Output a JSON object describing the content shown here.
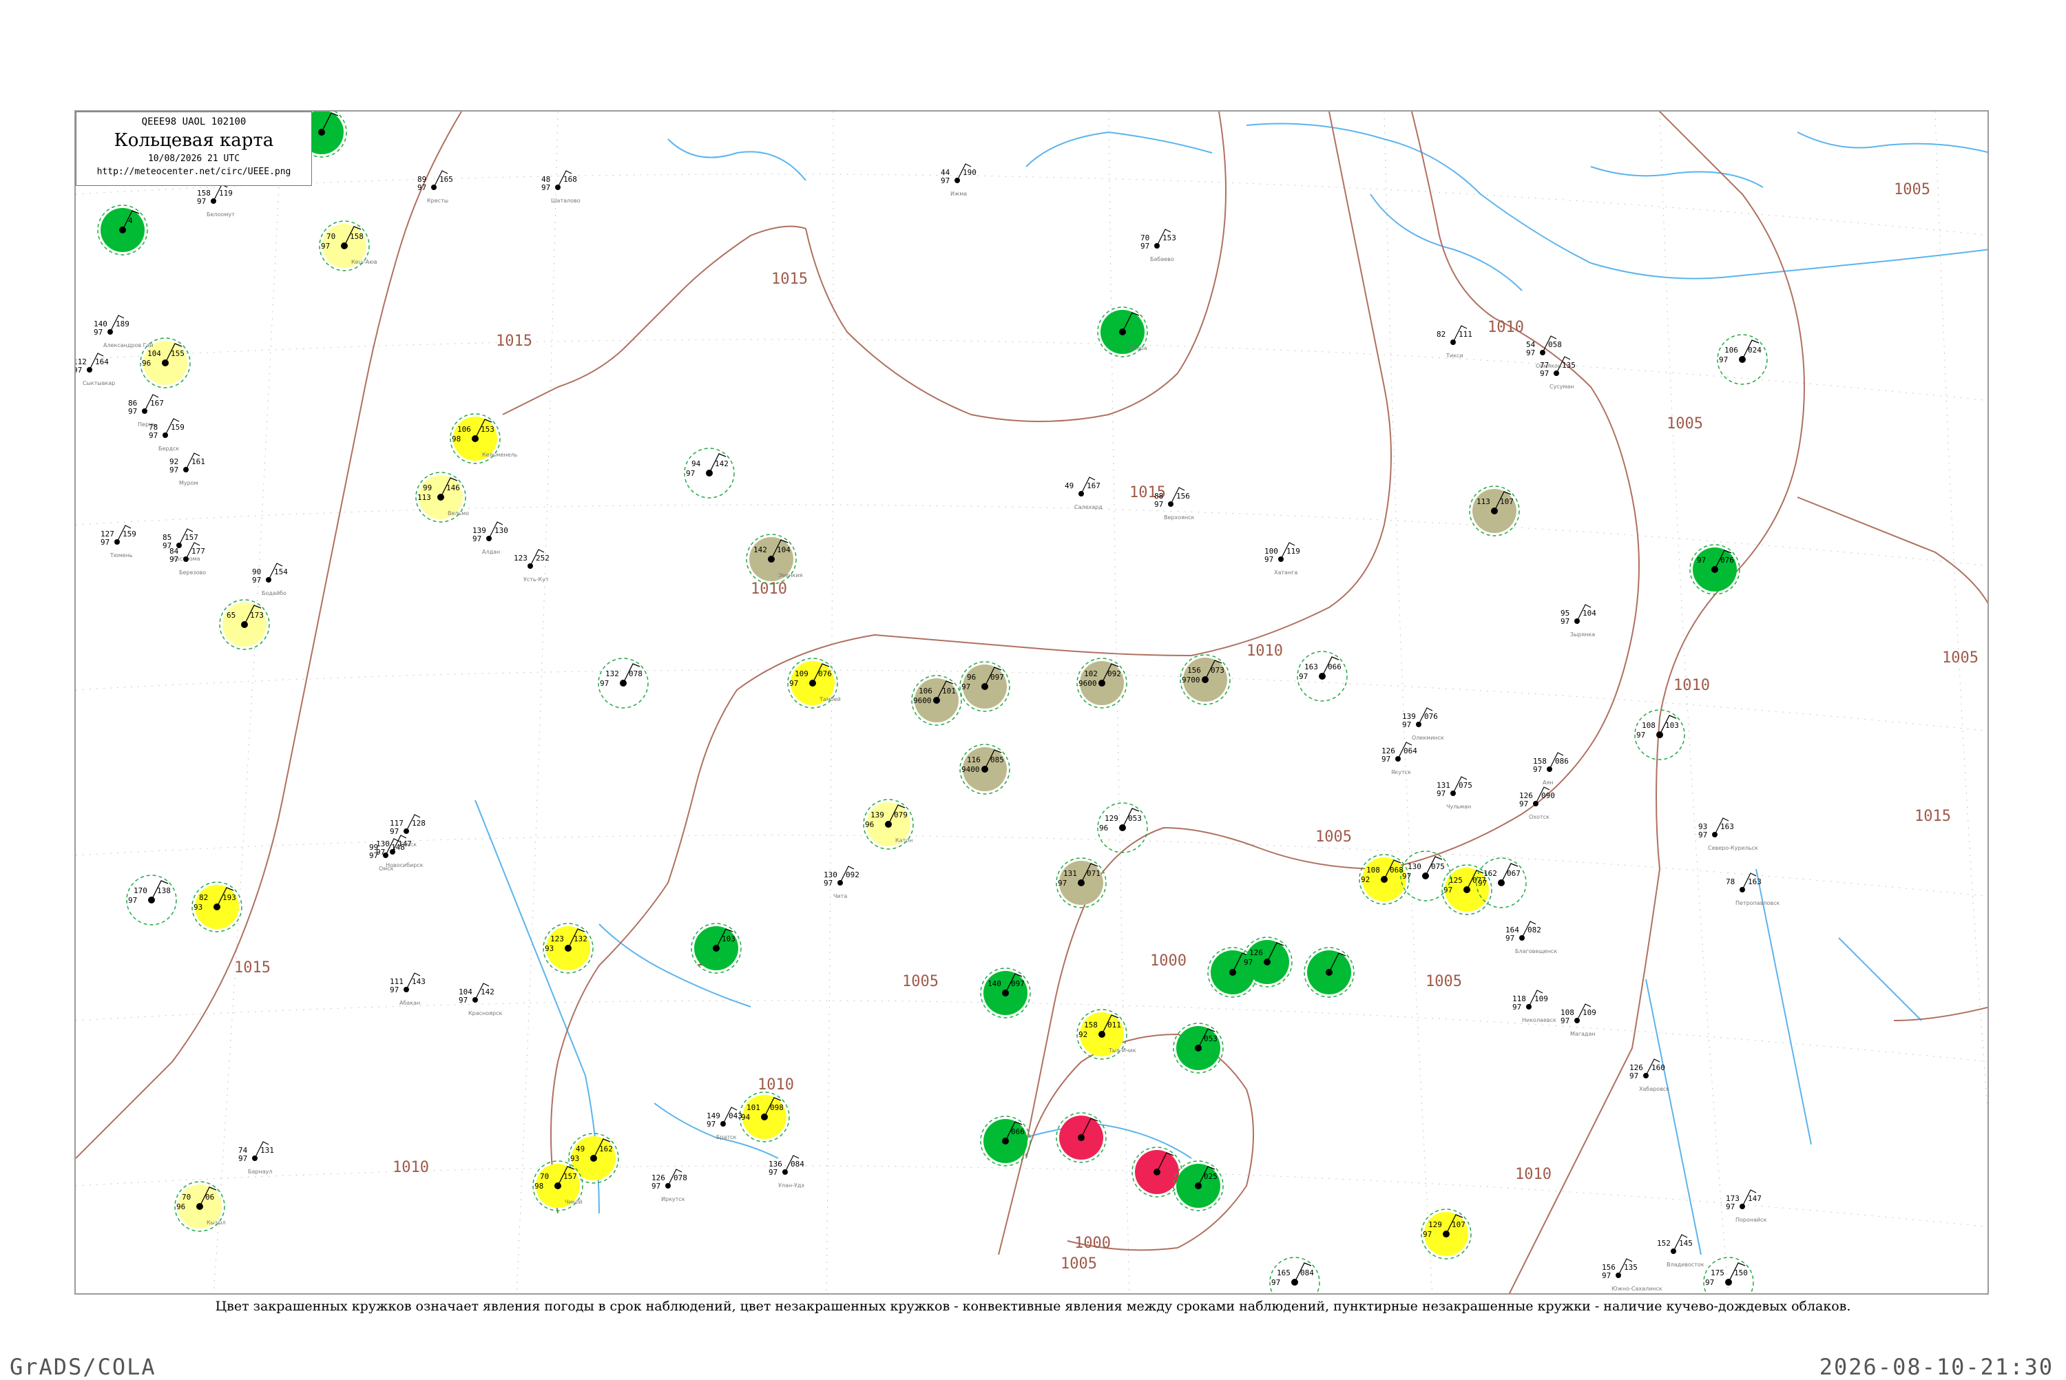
{
  "header": {
    "code": "QEEE98  UAOL  102100",
    "title": "Кольцевая карта",
    "date": "10/08/2026 21 UTC",
    "url": "http://meteocenter.net/circ/UEEE.png"
  },
  "legend_text": "Цвет закрашенных кружков означает явления погоды в срок наблюдений, цвет незакрашенных кружков - конвективные явления между сроками наблюдений, пунктирные незакрашенные кружки - наличие кучево-дождевых облаков.",
  "software": "GrADS/COLA",
  "timestamp": "2026-08-10-21:30",
  "colors": {
    "green": "#00bb33",
    "yellow": "#ffff22",
    "pale_yellow": "#ffff99",
    "olive": "#bdb98e",
    "red": "#ee2255",
    "dashed_ring": "#22aa44",
    "isobar": "#b07060",
    "river": "#44aaee",
    "gridline": "#bbbbbb"
  },
  "isobar_labels": [
    "1015",
    "1015",
    "1015",
    "1015",
    "1010",
    "1010",
    "1010",
    "1010",
    "1010",
    "1010",
    "1010",
    "1005",
    "1005",
    "1005",
    "1005",
    "1005",
    "1005",
    "1005",
    "1000",
    "1000",
    "1015",
    "1010"
  ],
  "stations": [
    {
      "id": "s01",
      "kind": "green",
      "name": "",
      "top": "",
      "left": "",
      "right": ""
    },
    {
      "id": "s02",
      "kind": "green",
      "name": "",
      "top": "",
      "left": "",
      "right": ""
    },
    {
      "id": "s03",
      "kind": "green",
      "name": "",
      "top": "",
      "left": "",
      "right": "4"
    },
    {
      "id": "s04",
      "kind": "pale_yellow",
      "name": "Кеш-Аюв",
      "top": "70",
      "left": "97",
      "right": "158"
    },
    {
      "id": "s05",
      "kind": "pale_yellow",
      "name": "",
      "top": "104",
      "left": "96",
      "right": "155"
    },
    {
      "id": "s06",
      "kind": "yellow",
      "name": "Кельменель",
      "top": "106",
      "left": "98",
      "right": "153"
    },
    {
      "id": "s07",
      "kind": "pale_yellow",
      "name": "Вельмо",
      "top": "99",
      "left": "113",
      "right": "146"
    },
    {
      "id": "s08",
      "kind": "green",
      "name": "Ичара",
      "top": "",
      "left": "",
      "right": ""
    },
    {
      "id": "s09",
      "kind": "ring",
      "name": "",
      "top": "94",
      "left": "97",
      "right": "142"
    },
    {
      "id": "s10",
      "kind": "olive",
      "name": "Эвенкия",
      "top": "142",
      "left": "",
      "right": "104"
    },
    {
      "id": "s11",
      "kind": "olive",
      "name": "",
      "top": "113",
      "left": "",
      "right": "107"
    },
    {
      "id": "s12",
      "kind": "green",
      "name": "",
      "top": "97",
      "left": "",
      "right": "076"
    },
    {
      "id": "s13",
      "kind": "pale_yellow",
      "name": "",
      "top": "65",
      "left": "",
      "right": "173"
    },
    {
      "id": "s14",
      "kind": "ring",
      "name": "",
      "top": "132",
      "left": "97",
      "right": "078"
    },
    {
      "id": "s15",
      "kind": "yellow",
      "name": "Тамбей",
      "top": "109",
      "left": "97",
      "right": "076"
    },
    {
      "id": "s16",
      "kind": "olive",
      "name": "",
      "top": "106",
      "left": "9600",
      "right": "101"
    },
    {
      "id": "s17",
      "kind": "olive",
      "name": "",
      "top": "96",
      "left": "97",
      "right": "097"
    },
    {
      "id": "s18",
      "kind": "olive",
      "name": "",
      "top": "102",
      "left": "9600",
      "right": "092"
    },
    {
      "id": "s19",
      "kind": "olive",
      "name": "",
      "top": "156",
      "left": "9700",
      "right": "073"
    },
    {
      "id": "s20",
      "kind": "ring",
      "name": "",
      "top": "163",
      "left": "97",
      "right": "066"
    },
    {
      "id": "s21",
      "kind": "ring",
      "name": "",
      "top": "108",
      "left": "97",
      "right": "103"
    },
    {
      "id": "s22",
      "kind": "olive",
      "name": "",
      "top": "116",
      "left": "9400",
      "right": "085"
    },
    {
      "id": "s23",
      "kind": "pale_yellow",
      "name": "Катон",
      "top": "139",
      "left": "96",
      "right": "079"
    },
    {
      "id": "s24",
      "kind": "ring",
      "name": "",
      "top": "129",
      "left": "96",
      "right": "053"
    },
    {
      "id": "s25",
      "kind": "olive",
      "name": "",
      "top": "131",
      "left": "97",
      "right": "071"
    },
    {
      "id": "s26",
      "kind": "yellow",
      "name": "",
      "top": "108",
      "left": "92",
      "right": "068"
    },
    {
      "id": "s27",
      "kind": "yellow",
      "name": "",
      "top": "125",
      "left": "97",
      "right": "077"
    },
    {
      "id": "s28",
      "kind": "yellow",
      "name": "",
      "top": "82",
      "left": "93",
      "right": "193"
    },
    {
      "id": "s29",
      "kind": "yellow",
      "name": "",
      "top": "123",
      "left": "93",
      "right": "132"
    },
    {
      "id": "s30",
      "kind": "green",
      "name": "",
      "top": "",
      "left": "",
      "right": "103"
    },
    {
      "id": "s31",
      "kind": "green",
      "name": "",
      "top": "140",
      "left": "",
      "right": "097"
    },
    {
      "id": "s32",
      "kind": "green",
      "name": "",
      "top": "",
      "left": "",
      "right": ""
    },
    {
      "id": "s33",
      "kind": "green",
      "name": "",
      "top": "126",
      "left": "97",
      "right": ""
    },
    {
      "id": "s34",
      "kind": "green",
      "name": "",
      "top": "",
      "left": "",
      "right": ""
    },
    {
      "id": "s35",
      "kind": "yellow",
      "name": "Тыя-Ичик",
      "top": "158",
      "left": "92",
      "right": "011"
    },
    {
      "id": "s36",
      "kind": "green",
      "name": "",
      "top": "",
      "left": "",
      "right": "053"
    },
    {
      "id": "s37",
      "kind": "yellow",
      "name": "",
      "top": "101",
      "left": "94",
      "right": "098"
    },
    {
      "id": "s38",
      "kind": "yellow",
      "name": "",
      "top": "49",
      "left": "93",
      "right": "162"
    },
    {
      "id": "s39",
      "kind": "yellow",
      "name": "Чикой",
      "top": "70",
      "left": "98",
      "right": "157"
    },
    {
      "id": "s40",
      "kind": "green",
      "name": "",
      "top": "",
      "left": "",
      "right": "066"
    },
    {
      "id": "s41",
      "kind": "red",
      "name": "",
      "top": "",
      "left": "",
      "right": ""
    },
    {
      "id": "s42",
      "kind": "red",
      "name": "",
      "top": "",
      "left": "",
      "right": ""
    },
    {
      "id": "s43",
      "kind": "green",
      "name": "",
      "top": "",
      "left": "",
      "right": "025"
    },
    {
      "id": "s44",
      "kind": "yellow",
      "name": "",
      "top": "129",
      "left": "97",
      "right": "107"
    },
    {
      "id": "s45",
      "kind": "pale_yellow",
      "name": "Кызыл",
      "top": "70",
      "left": "96",
      "right": "06"
    },
    {
      "id": "s46",
      "kind": "ring",
      "name": "",
      "top": "170",
      "left": "97",
      "right": "138"
    },
    {
      "id": "s47",
      "kind": "ring",
      "name": "",
      "top": "130",
      "left": "97",
      "right": "075"
    },
    {
      "id": "s48",
      "kind": "ring",
      "name": "",
      "top": "162",
      "left": "97",
      "right": "067"
    },
    {
      "id": "s49",
      "kind": "ring",
      "name": "",
      "top": "106",
      "left": "97",
      "right": "024"
    },
    {
      "id": "s50",
      "kind": "ring",
      "name": "",
      "top": "165",
      "left": "97",
      "right": "084"
    },
    {
      "id": "s51",
      "kind": "ring",
      "name": "",
      "top": "175",
      "left": "97",
      "right": "150"
    }
  ],
  "plain_stations": [
    {
      "name": "Белоомут",
      "top": "158",
      "left": "97",
      "right": "119"
    },
    {
      "name": "Кресты",
      "top": "89",
      "left": "97",
      "right": "165"
    },
    {
      "name": "Шаталово",
      "top": "48",
      "left": "97",
      "right": "168"
    },
    {
      "name": "Ижма",
      "top": "44",
      "left": "97",
      "right": "190"
    },
    {
      "name": "Бабаево",
      "top": "70",
      "left": "97",
      "right": "153"
    },
    {
      "name": "Сыктывкар",
      "top": "112",
      "left": "97",
      "right": "164"
    },
    {
      "name": "Александров Гай",
      "top": "140",
      "left": "97",
      "right": "189"
    },
    {
      "name": "Пермь",
      "top": "86",
      "left": "97",
      "right": "167"
    },
    {
      "name": "Бердск",
      "top": "78",
      "left": "97",
      "right": "159"
    },
    {
      "name": "Муром",
      "top": "92",
      "left": "97",
      "right": "161"
    },
    {
      "name": "Кострома",
      "top": "85",
      "left": "97",
      "right": "157"
    },
    {
      "name": "Тюмень",
      "top": "127",
      "left": "97",
      "right": "159"
    },
    {
      "name": "Березово",
      "top": "84",
      "left": "97",
      "right": "177"
    },
    {
      "name": "Алдан",
      "top": "139",
      "left": "97",
      "right": "130"
    },
    {
      "name": "Усть-Кут",
      "top": "123",
      "left": "",
      "right": "252"
    },
    {
      "name": "Бодайбо",
      "top": "90",
      "left": "97",
      "right": "154"
    },
    {
      "name": "Хатанга",
      "top": "100",
      "left": "97",
      "right": "119"
    },
    {
      "name": "Тикси",
      "top": "82",
      "left": "",
      "right": "111"
    },
    {
      "name": "Сусуман",
      "top": "77",
      "left": "97",
      "right": "135"
    },
    {
      "name": "Оймякон",
      "top": "54",
      "left": "97",
      "right": "058"
    },
    {
      "name": "Зырянка",
      "top": "95",
      "left": "97",
      "right": "104"
    },
    {
      "name": "Верхоянск",
      "top": "88",
      "left": "97",
      "right": "156"
    },
    {
      "name": "Салехард",
      "top": "49",
      "left": "",
      "right": "167"
    },
    {
      "name": "Олекминск",
      "top": "139",
      "left": "97",
      "right": "076"
    },
    {
      "name": "Якутск",
      "top": "126",
      "left": "97",
      "right": "064"
    },
    {
      "name": "Чульман",
      "top": "131",
      "left": "97",
      "right": "075"
    },
    {
      "name": "Охотск",
      "top": "126",
      "left": "97",
      "right": "090"
    },
    {
      "name": "Аян",
      "top": "158",
      "left": "97",
      "right": "086"
    },
    {
      "name": "Магадан",
      "top": "108",
      "left": "97",
      "right": "109"
    },
    {
      "name": "Северо-Курильск",
      "top": "93",
      "left": "97",
      "right": "163"
    },
    {
      "name": "Петропавловск",
      "top": "78",
      "left": "",
      "right": "163"
    },
    {
      "name": "Николаевск",
      "top": "118",
      "left": "97",
      "right": "109"
    },
    {
      "name": "Хабаровск",
      "top": "126",
      "left": "97",
      "right": "160"
    },
    {
      "name": "Поронайск",
      "top": "173",
      "left": "97",
      "right": "147"
    },
    {
      "name": "Владивосток",
      "top": "152",
      "left": "",
      "right": "145"
    },
    {
      "name": "Южно-Сахалинск",
      "top": "156",
      "left": "97",
      "right": "135"
    },
    {
      "name": "Благовещенск",
      "top": "164",
      "left": "97",
      "right": "082"
    },
    {
      "name": "Чита",
      "top": "130",
      "left": "97",
      "right": "092"
    },
    {
      "name": "Улан-Удэ",
      "top": "136",
      "left": "97",
      "right": "084"
    },
    {
      "name": "Иркутск",
      "top": "126",
      "left": "97",
      "right": "078"
    },
    {
      "name": "Братск",
      "top": "149",
      "left": "97",
      "right": "043"
    },
    {
      "name": "Барнаул",
      "top": "74",
      "left": "97",
      "right": "131"
    },
    {
      "name": "Омск",
      "top": "99",
      "left": "97",
      "right": "148"
    },
    {
      "name": "Новосибирск",
      "top": "130",
      "left": "97",
      "right": "147"
    },
    {
      "name": "Томск",
      "top": "117",
      "left": "97",
      "right": "128"
    },
    {
      "name": "Абакан",
      "top": "111",
      "left": "97",
      "right": "143"
    },
    {
      "name": "Красноярск",
      "top": "104",
      "left": "97",
      "right": "142"
    }
  ]
}
